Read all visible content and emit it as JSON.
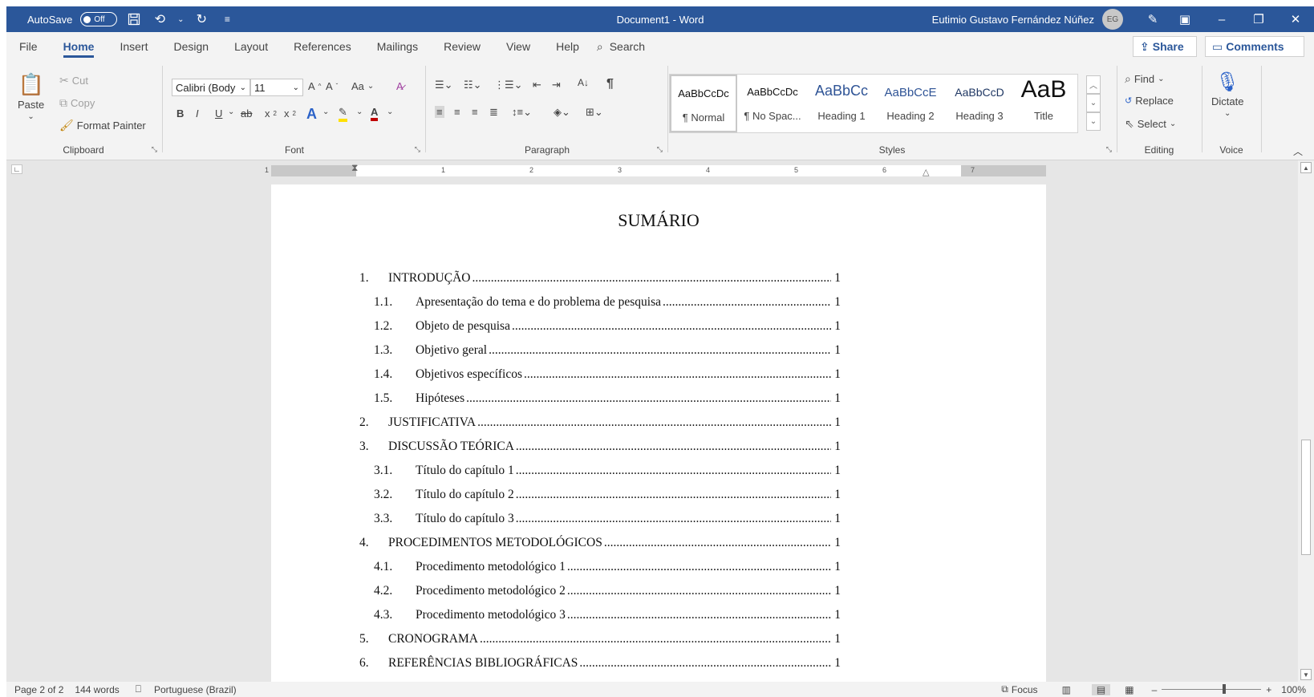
{
  "titlebar": {
    "autosave_label": "AutoSave",
    "autosave_state": "Off",
    "title": "Document1  -  Word",
    "user": "Eutimio Gustavo Fernández Núñez",
    "avatar_initials": "EG"
  },
  "tabs": [
    "File",
    "Home",
    "Insert",
    "Design",
    "Layout",
    "References",
    "Mailings",
    "Review",
    "View",
    "Help"
  ],
  "search_label": "Search",
  "share_label": "Share",
  "comments_label": "Comments",
  "clipboard": {
    "paste": "Paste",
    "cut": "Cut",
    "copy": "Copy",
    "format_painter": "Format Painter",
    "label": "Clipboard"
  },
  "font": {
    "name": "Calibri (Body",
    "size": "11",
    "case_label": "Aa",
    "label": "Font"
  },
  "paragraph": {
    "label": "Paragraph"
  },
  "styles": {
    "label": "Styles",
    "items": [
      {
        "sample": "AaBbCcDc",
        "name": "¶ Normal"
      },
      {
        "sample": "AaBbCcDc",
        "name": "¶ No Spac..."
      },
      {
        "sample": "AaBbCc",
        "name": "Heading 1"
      },
      {
        "sample": "AaBbCcE",
        "name": "Heading 2"
      },
      {
        "sample": "AaBbCcD",
        "name": "Heading 3"
      },
      {
        "sample": "AaB",
        "name": "Title"
      }
    ]
  },
  "editing": {
    "find": "Find",
    "replace": "Replace",
    "select": "Select",
    "label": "Editing"
  },
  "voice": {
    "dictate": "Dictate",
    "label": "Voice"
  },
  "ruler": {
    "numbers": [
      "1",
      "1",
      "2",
      "3",
      "4",
      "5",
      "6",
      "7"
    ]
  },
  "document": {
    "title": "SUMÁRIO",
    "toc": [
      {
        "level": 1,
        "num": "1.",
        "text": "INTRODUÇÃO",
        "page": "1"
      },
      {
        "level": 2,
        "num": "1.1.",
        "text": "Apresentação do tema e do problema de pesquisa",
        "page": "1"
      },
      {
        "level": 2,
        "num": "1.2.",
        "text": "Objeto de pesquisa",
        "page": "1"
      },
      {
        "level": 2,
        "num": "1.3.",
        "text": "Objetivo geral",
        "page": "1"
      },
      {
        "level": 2,
        "num": "1.4.",
        "text": "Objetivos específicos",
        "page": "1"
      },
      {
        "level": 2,
        "num": "1.5.",
        "text": "Hipóteses",
        "page": "1"
      },
      {
        "level": 1,
        "num": "2.",
        "text": "JUSTIFICATIVA",
        "page": "1"
      },
      {
        "level": 1,
        "num": "3.",
        "text": "DISCUSSÃO TEÓRICA",
        "page": "1"
      },
      {
        "level": 2,
        "num": "3.1.",
        "text": "Título do capítulo 1",
        "page": "1"
      },
      {
        "level": 2,
        "num": "3.2.",
        "text": "Título do capítulo 2",
        "page": "1"
      },
      {
        "level": 2,
        "num": "3.3.",
        "text": "Título do capítulo 3",
        "page": "1"
      },
      {
        "level": 1,
        "num": "4.",
        "text": "PROCEDIMENTOS METODOLÓGICOS",
        "page": "1"
      },
      {
        "level": 2,
        "num": "4.1.",
        "text": "Procedimento metodológico 1",
        "page": "1"
      },
      {
        "level": 2,
        "num": "4.2.",
        "text": "Procedimento metodológico 2",
        "page": "1"
      },
      {
        "level": 2,
        "num": "4.3.",
        "text": "Procedimento metodológico 3",
        "page": "1"
      },
      {
        "level": 1,
        "num": "5.",
        "text": "CRONOGRAMA",
        "page": "1"
      },
      {
        "level": 1,
        "num": "6.",
        "text": "REFERÊNCIAS BIBLIOGRÁFICAS",
        "page": "1"
      }
    ]
  },
  "status": {
    "page": "Page 2 of 2",
    "words": "144 words",
    "language": "Portuguese (Brazil)",
    "focus": "Focus",
    "zoom": "100%",
    "zoom_level": 100
  },
  "colors": {
    "accent": "#2b579a",
    "canvas": "#e6e6e6",
    "ribbon": "#f3f3f3"
  },
  "icons": [
    "save-icon",
    "undo-icon",
    "redo-icon",
    "customize-icon",
    "coauthor-icon",
    "ribbon-display-icon",
    "minimize-icon",
    "restore-icon",
    "close-icon",
    "search-icon",
    "share-icon",
    "comment-icon",
    "paste-icon",
    "cut-icon",
    "copy-icon",
    "format-painter-icon",
    "find-icon",
    "replace-icon",
    "select-icon",
    "microphone-icon"
  ]
}
